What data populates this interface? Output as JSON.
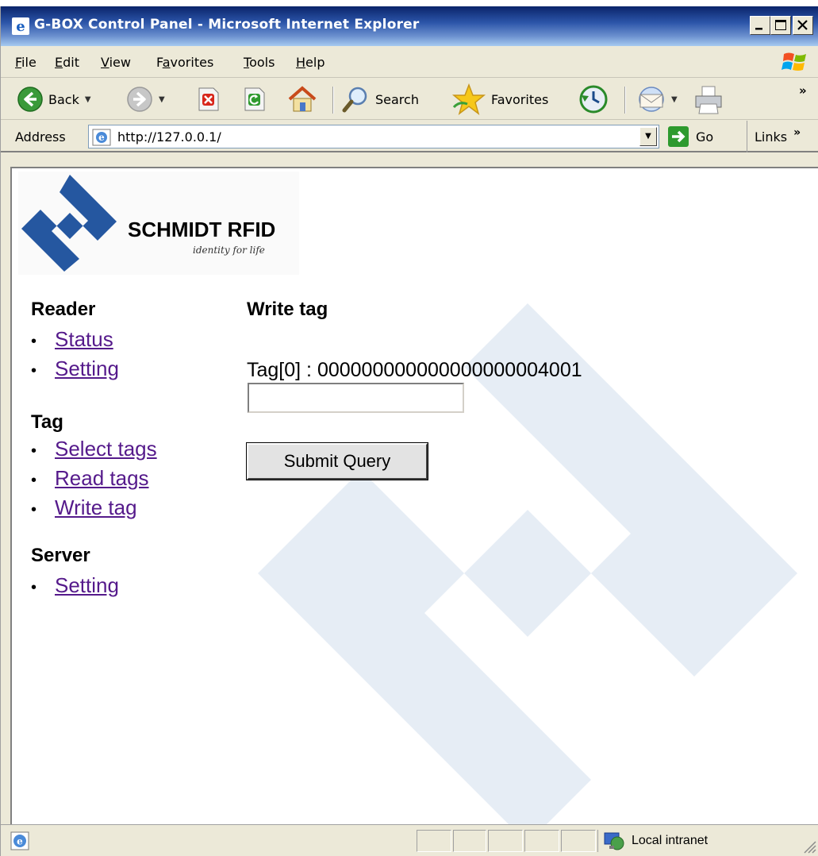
{
  "window": {
    "title": "G-BOX Control Panel - Microsoft Internet Explorer"
  },
  "menu": [
    "File",
    "Edit",
    "View",
    "Favorites",
    "Tools",
    "Help"
  ],
  "menu_accel": [
    "F",
    "E",
    "V",
    "a",
    "T",
    "H"
  ],
  "toolbar": {
    "back": "Back",
    "search": "Search",
    "favorites": "Favorites",
    "more": "»"
  },
  "address": {
    "label": "Address",
    "url": "http://127.0.0.1/",
    "go": "Go",
    "links": "Links"
  },
  "logo": {
    "name": "SCHMIDT RFID",
    "tagline": "identity for life"
  },
  "nav": {
    "reader": {
      "heading": "Reader",
      "items": [
        "Status",
        "Setting"
      ]
    },
    "tag": {
      "heading": "Tag",
      "items": [
        "Select tags",
        "Read tags",
        "Write tag"
      ]
    },
    "server": {
      "heading": "Server",
      "items": [
        "Setting"
      ]
    }
  },
  "main": {
    "heading": "Write tag",
    "tag_label": "Tag[0] : 000000000000000000004001",
    "input_value": "",
    "submit": "Submit Query"
  },
  "status": {
    "zone": "Local intranet"
  }
}
